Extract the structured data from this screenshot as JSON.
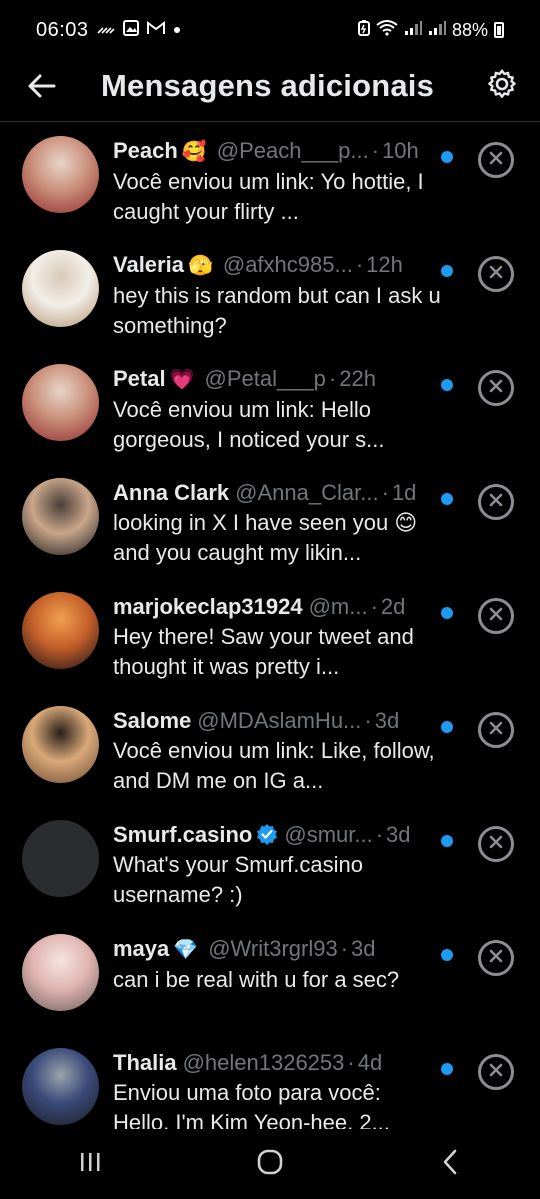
{
  "status_bar": {
    "time": "06:03",
    "battery": "88%",
    "left_icons": [
      "signal-strength-icon",
      "image-icon",
      "gmail-icon",
      "dot-icon"
    ],
    "right_icons": [
      "battery-saver-icon",
      "wifi-icon",
      "signal-icon",
      "signal-icon"
    ]
  },
  "header": {
    "title": "Mensagens adicionais",
    "back_icon": "arrow-left-icon",
    "settings_icon": "gear-icon"
  },
  "conversations": [
    {
      "name": "Peach",
      "emoji": "🥰",
      "handle": "@Peach___p...",
      "time": "10h",
      "preview": "Você enviou um link: Yo hottie, I caught your flirty ...",
      "unread": true,
      "avatar_colors": [
        "#e8d4c9",
        "#c98f7a",
        "#8f2a2f"
      ]
    },
    {
      "name": "Valeria",
      "emoji": "🫣",
      "handle": "@afxhc985...",
      "time": "12h",
      "preview": "hey this is random but can I ask u something?",
      "unread": true,
      "avatar_colors": [
        "#d8c9b7",
        "#f2eee8",
        "#b39170"
      ]
    },
    {
      "name": "Petal",
      "emoji": "💗",
      "handle": "@Petal___p",
      "time": "22h",
      "preview": "Você enviou um link: Hello gorgeous, I noticed your s...",
      "unread": true,
      "avatar_colors": [
        "#e8d4c9",
        "#c98f7a",
        "#8f2a2f"
      ]
    },
    {
      "name": "Anna Clark",
      "emoji": "",
      "handle": "@Anna_Clar...",
      "time": "1d",
      "preview": "looking in X I have seen you 😊 and you caught my likin...",
      "unread": true,
      "avatar_colors": [
        "#4a3f3a",
        "#c9a58a",
        "#1a1a1a"
      ]
    },
    {
      "name": "marjokeclap31924",
      "emoji": "",
      "handle": "@m...",
      "time": "2d",
      "preview": "Hey there! Saw your tweet and thought it was pretty i...",
      "unread": true,
      "avatar_colors": [
        "#f0a050",
        "#c4602a",
        "#1a1015"
      ]
    },
    {
      "name": "Salome",
      "emoji": "",
      "handle": "@MDAslamHu...",
      "time": "3d",
      "preview": "Você enviou um link: Like, follow, and DM me on IG a...",
      "unread": true,
      "avatar_colors": [
        "#2a1f1a",
        "#d9a878",
        "#6b4a33"
      ]
    },
    {
      "name": "Smurf.casino",
      "emoji": "",
      "handle": "@smur...",
      "time": "3d",
      "preview": "What's your Smurf.casino username? :)",
      "unread": true,
      "verified": true,
      "avatar_colors": [
        "#2a2c2f",
        "#2a2c2f",
        "#2a2c2f"
      ]
    },
    {
      "name": "maya",
      "emoji": "💎",
      "handle": "@Writ3rgrl93",
      "time": "3d",
      "preview": "can i be real with u for a sec?",
      "unread": true,
      "avatar_colors": [
        "#f3e4e0",
        "#e0b4b0",
        "#6a5b5a"
      ]
    },
    {
      "name": "Thalia",
      "emoji": "",
      "handle": "@helen1326253",
      "time": "4d",
      "preview": "Enviou uma foto para você: Hello, I'm Kim Yeon-hee, 2...",
      "unread": true,
      "avatar_colors": [
        "#9aa3aa",
        "#3a4a7a",
        "#1c1c22"
      ]
    }
  ],
  "navbar": {
    "recents_icon": "recent-apps-icon",
    "home_icon": "home-icon",
    "back_icon": "back-chevron-icon"
  }
}
